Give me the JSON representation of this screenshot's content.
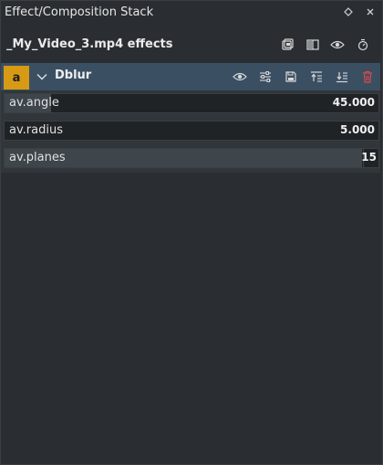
{
  "panel": {
    "title": "Effect/Composition Stack",
    "float_icon": "diamond-icon",
    "close_icon": "close-icon"
  },
  "clip": {
    "name": "_My_Video_3.mp4 effects",
    "buttons": [
      {
        "name": "save-stack-icon"
      },
      {
        "name": "split-compare-icon"
      },
      {
        "name": "eye-icon"
      },
      {
        "name": "stopwatch-icon"
      }
    ]
  },
  "effect": {
    "badge": "a",
    "name": "Dblur",
    "accent": "#d69a14",
    "header_color": "#3b4f63",
    "delete_color": "#e04848",
    "params": [
      {
        "label": "av.angle",
        "value": "45.000",
        "fill": 0.125
      },
      {
        "label": "av.radius",
        "value": "5.000",
        "fill": 0.0
      },
      {
        "label": "av.planes",
        "value": "15",
        "fill": 0.96
      }
    ]
  }
}
